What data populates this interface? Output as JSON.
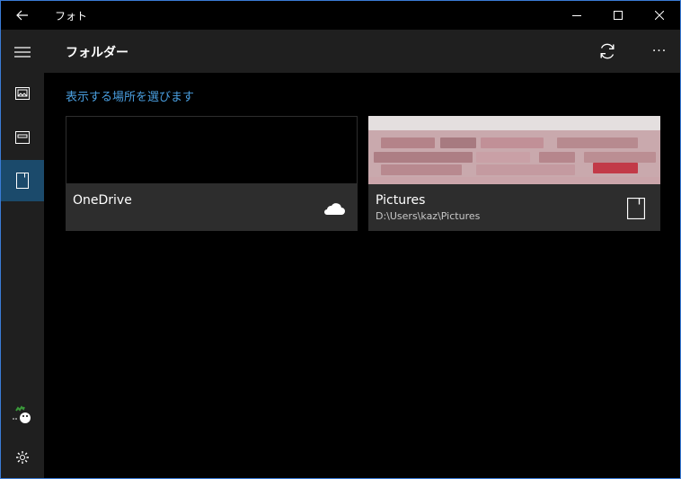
{
  "titlebar": {
    "title": "フォト",
    "back_icon": "back-arrow-icon",
    "minimize_icon": "minimize-icon",
    "maximize_icon": "maximize-icon",
    "close_icon": "close-icon"
  },
  "sidebar": {
    "items": [
      {
        "icon": "hamburger-menu-icon"
      },
      {
        "icon": "collection-icon"
      },
      {
        "icon": "album-icon"
      },
      {
        "icon": "folder-icon",
        "active": true
      }
    ],
    "account_icon": "avatar-icon",
    "settings_icon": "gear-icon"
  },
  "header": {
    "title": "フォルダー",
    "refresh_icon": "refresh-icon",
    "more_label": "···"
  },
  "main": {
    "choose_link": "表示する場所を選びます",
    "tiles": [
      {
        "name": "OneDrive",
        "path": "",
        "icon": "cloud-icon"
      },
      {
        "name": "Pictures",
        "path": "D:\\Users\\kaz\\Pictures",
        "icon": "folder-icon"
      }
    ]
  },
  "colors": {
    "accent": "#1b4a6b",
    "link": "#4a9fe0",
    "sidebar_bg": "#1f1f1f",
    "tile_bg": "#2d2d2d",
    "window_border": "#3a7bd5"
  }
}
